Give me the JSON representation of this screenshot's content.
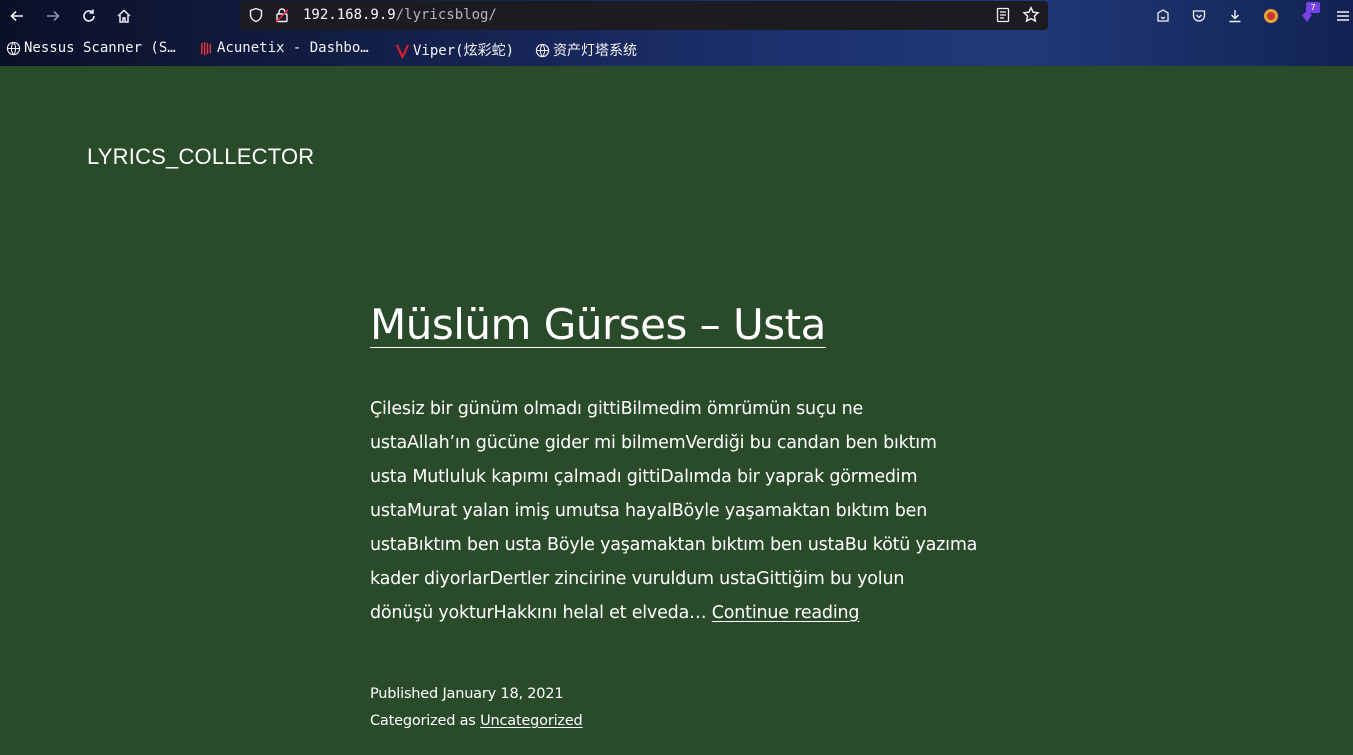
{
  "browser": {
    "url_host": "192.168.9.9",
    "url_path": "/lyricsblog/",
    "extension_badge": "7",
    "icons": {
      "back": "arrow-left-icon",
      "forward": "arrow-right-icon",
      "reload": "reload-icon",
      "home": "home-icon",
      "shield": "shield-icon",
      "lock": "lock-insecure-icon",
      "reader": "reader-mode-icon",
      "bookmark_star": "star-icon",
      "pocket": "pocket-icon",
      "downloads": "download-icon",
      "menu": "hamburger-menu-icon"
    },
    "bookmarks": [
      {
        "label": "Nessus Scanner (S…",
        "icon": "globe-icon"
      },
      {
        "label": "Acunetix - Dashbo…",
        "icon": "acunetix-icon"
      },
      {
        "label": "Viper(炫彩蛇)",
        "icon": "viper-icon"
      },
      {
        "label": "资产灯塔系统",
        "icon": "globe-icon"
      }
    ]
  },
  "site": {
    "title": "LYRICS_COLLECTOR"
  },
  "post": {
    "title": "Müslüm Gürses – Usta",
    "excerpt_lines": [
      "Çilesiz bir günüm olmadı gittiBilmedim ömrümün suçu ne",
      "ustaAllah’ın gücüne gider mi bilmemVerdiği bu candan ben bıktım",
      "usta Mutluluk kapımı çalmadı gittiDalımda bir yaprak görmedim",
      "ustaMurat yalan imiş umutsa hayalBöyle yaşamaktan bıktım ben",
      "ustaBıktım ben usta Böyle yaşamaktan bıktım ben ustaBu kötü yazıma",
      "kader diyorlarDertler zincirine vuruldum ustaGittiğim bu yolun",
      "dönüşü yokturHakkını helal et elveda…"
    ],
    "continue_label": "Continue reading",
    "published_prefix": "Published",
    "published_date": "January 18, 2021",
    "category_prefix": "Categorized as",
    "category": "Uncategorized"
  },
  "colors": {
    "page_background": "#2a4b2a",
    "text": "#ffffff"
  }
}
